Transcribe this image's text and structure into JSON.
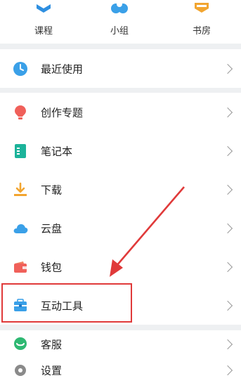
{
  "top_nav": [
    {
      "label": "课程",
      "icon": "course-icon"
    },
    {
      "label": "小组",
      "icon": "group-icon"
    },
    {
      "label": "书房",
      "icon": "study-icon"
    }
  ],
  "recent": {
    "label": "最近使用",
    "icon": "clock-icon"
  },
  "menu": [
    {
      "label": "创作专题",
      "icon": "lightbulb-icon"
    },
    {
      "label": "笔记本",
      "icon": "notebook-icon"
    },
    {
      "label": "下载",
      "icon": "download-icon"
    },
    {
      "label": "云盘",
      "icon": "cloud-icon"
    },
    {
      "label": "钱包",
      "icon": "wallet-icon"
    },
    {
      "label": "互动工具",
      "icon": "toolbox-icon"
    }
  ],
  "support": [
    {
      "label": "客服",
      "icon": "chat-icon"
    },
    {
      "label": "设置",
      "icon": "gear-icon"
    }
  ],
  "colors": {
    "annotation": "#e03a3a",
    "accent_blue": "#3aa0e8",
    "orange": "#f2a530"
  }
}
